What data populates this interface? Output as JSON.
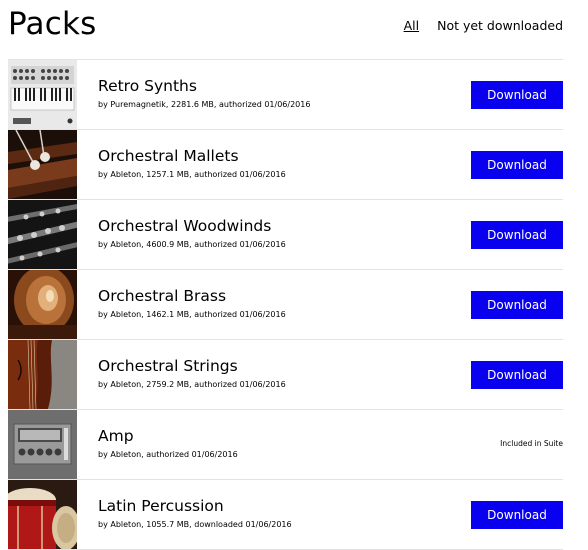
{
  "header": {
    "title": "Packs",
    "filters": {
      "all": "All",
      "not_downloaded": "Not yet downloaded"
    }
  },
  "packs": [
    {
      "name": "Retro Synths",
      "meta": "by Puremagnetik, 2281.6 MB, authorized 01/06/2016",
      "action": "Download",
      "thumb": "synth-keyboard-thumbnail"
    },
    {
      "name": "Orchestral Mallets",
      "meta": "by Ableton, 1257.1 MB, authorized 01/06/2016",
      "action": "Download",
      "thumb": "mallets-thumbnail"
    },
    {
      "name": "Orchestral Woodwinds",
      "meta": "by Ableton, 4600.9 MB, authorized 01/06/2016",
      "action": "Download",
      "thumb": "woodwinds-thumbnail"
    },
    {
      "name": "Orchestral Brass",
      "meta": "by Ableton, 1462.1 MB, authorized 01/06/2016",
      "action": "Download",
      "thumb": "brass-thumbnail"
    },
    {
      "name": "Orchestral Strings",
      "meta": "by Ableton, 2759.2 MB, authorized 01/06/2016",
      "action": "Download",
      "thumb": "violin-thumbnail"
    },
    {
      "name": "Amp",
      "meta": "by Ableton, authorized 01/06/2016",
      "status": "Included in Suite",
      "thumb": "amp-device-thumbnail"
    },
    {
      "name": "Latin Percussion",
      "meta": "by Ableton, 1055.7 MB, downloaded 01/06/2016",
      "action": "Download",
      "thumb": "percussion-thumbnail"
    }
  ],
  "colors": {
    "download_button": "#0a00f0",
    "divider": "#e3e3e3"
  }
}
